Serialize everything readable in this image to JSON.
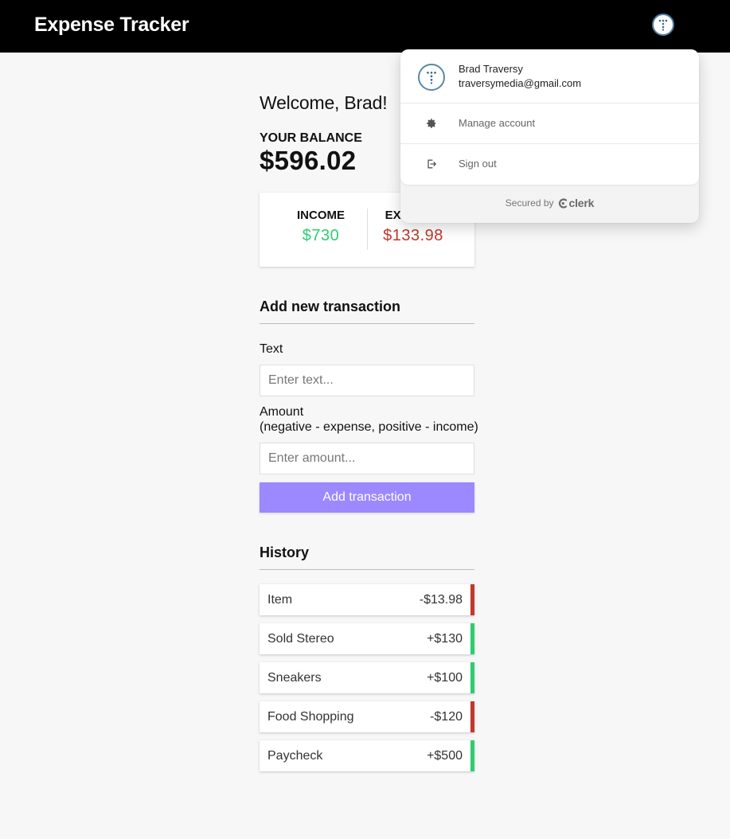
{
  "navbar": {
    "brand": "Expense Tracker"
  },
  "main": {
    "welcome": "Welcome, Brad!",
    "balance_label": "YOUR BALANCE",
    "balance": "$596.02",
    "income_label": "INCOME",
    "income": "$730",
    "expense_label": "EXPENSE",
    "expense": "$133.98"
  },
  "add_form": {
    "heading": "Add new transaction",
    "text_label": "Text",
    "text_placeholder": "Enter text...",
    "amount_label": "Amount",
    "amount_hint": "(negative - expense, positive - income)",
    "amount_placeholder": "Enter amount...",
    "submit_label": "Add transaction"
  },
  "history": {
    "heading": "History",
    "items": [
      {
        "text": "Item",
        "amount": "-$13.98"
      },
      {
        "text": "Sold Stereo",
        "amount": "+$130"
      },
      {
        "text": "Sneakers",
        "amount": "+$100"
      },
      {
        "text": "Food Shopping",
        "amount": "-$120"
      },
      {
        "text": "Paycheck",
        "amount": "+$500"
      }
    ]
  },
  "user_menu": {
    "name": "Brad Traversy",
    "email": "traversymedia@gmail.com",
    "manage_label": "Manage account",
    "signout_label": "Sign out",
    "secured_by": "Secured by",
    "provider": "clerk"
  },
  "colors": {
    "income": "#2ecc71",
    "expense": "#c0392b",
    "button": "#9c88ff",
    "navbar": "#000000"
  }
}
